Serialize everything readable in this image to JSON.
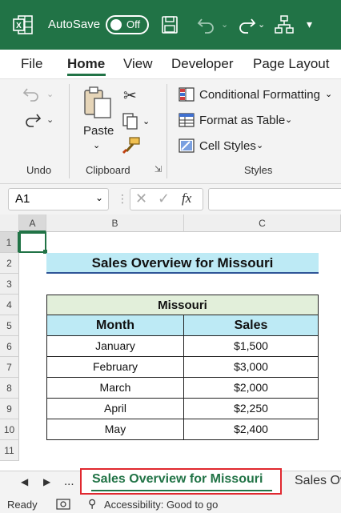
{
  "titlebar": {
    "autosave_label": "AutoSave",
    "toggle_label": "Off"
  },
  "tabs": [
    "File",
    "Home",
    "View",
    "Developer",
    "Page Layout"
  ],
  "ribbon": {
    "undo_group": "Undo",
    "clipboard_group": "Clipboard",
    "paste_label": "Paste",
    "styles_group": "Styles",
    "conditional_formatting": "Conditional Formatting",
    "format_as_table": "Format as Table",
    "cell_styles": "Cell Styles"
  },
  "formula_bar": {
    "name_box": "A1",
    "fx": "fx"
  },
  "columns": [
    "A",
    "B",
    "C"
  ],
  "rows": [
    "1",
    "2",
    "3",
    "4",
    "5",
    "6",
    "7",
    "8",
    "9",
    "10",
    "11"
  ],
  "sheet": {
    "title": "Sales Overview for Missouri",
    "table_header": "Missouri",
    "col_month": "Month",
    "col_sales": "Sales",
    "data": [
      {
        "month": "January",
        "sales": "$1,500"
      },
      {
        "month": "February",
        "sales": "$3,000"
      },
      {
        "month": "March",
        "sales": "$2,000"
      },
      {
        "month": "April",
        "sales": "$2,250"
      },
      {
        "month": "May",
        "sales": "$2,400"
      }
    ]
  },
  "sheet_tabs": {
    "ellipsis": "...",
    "active": "Sales Overview for Missouri",
    "next": "Sales Ov"
  },
  "status": {
    "ready": "Ready",
    "accessibility": "Accessibility: Good to go"
  },
  "colors": {
    "brand": "#217346",
    "title_fill": "#bdeaf5",
    "table_header_fill": "#e2efda",
    "subheader_fill": "#bdeaf5",
    "active_tab_border": "#e0282f"
  }
}
